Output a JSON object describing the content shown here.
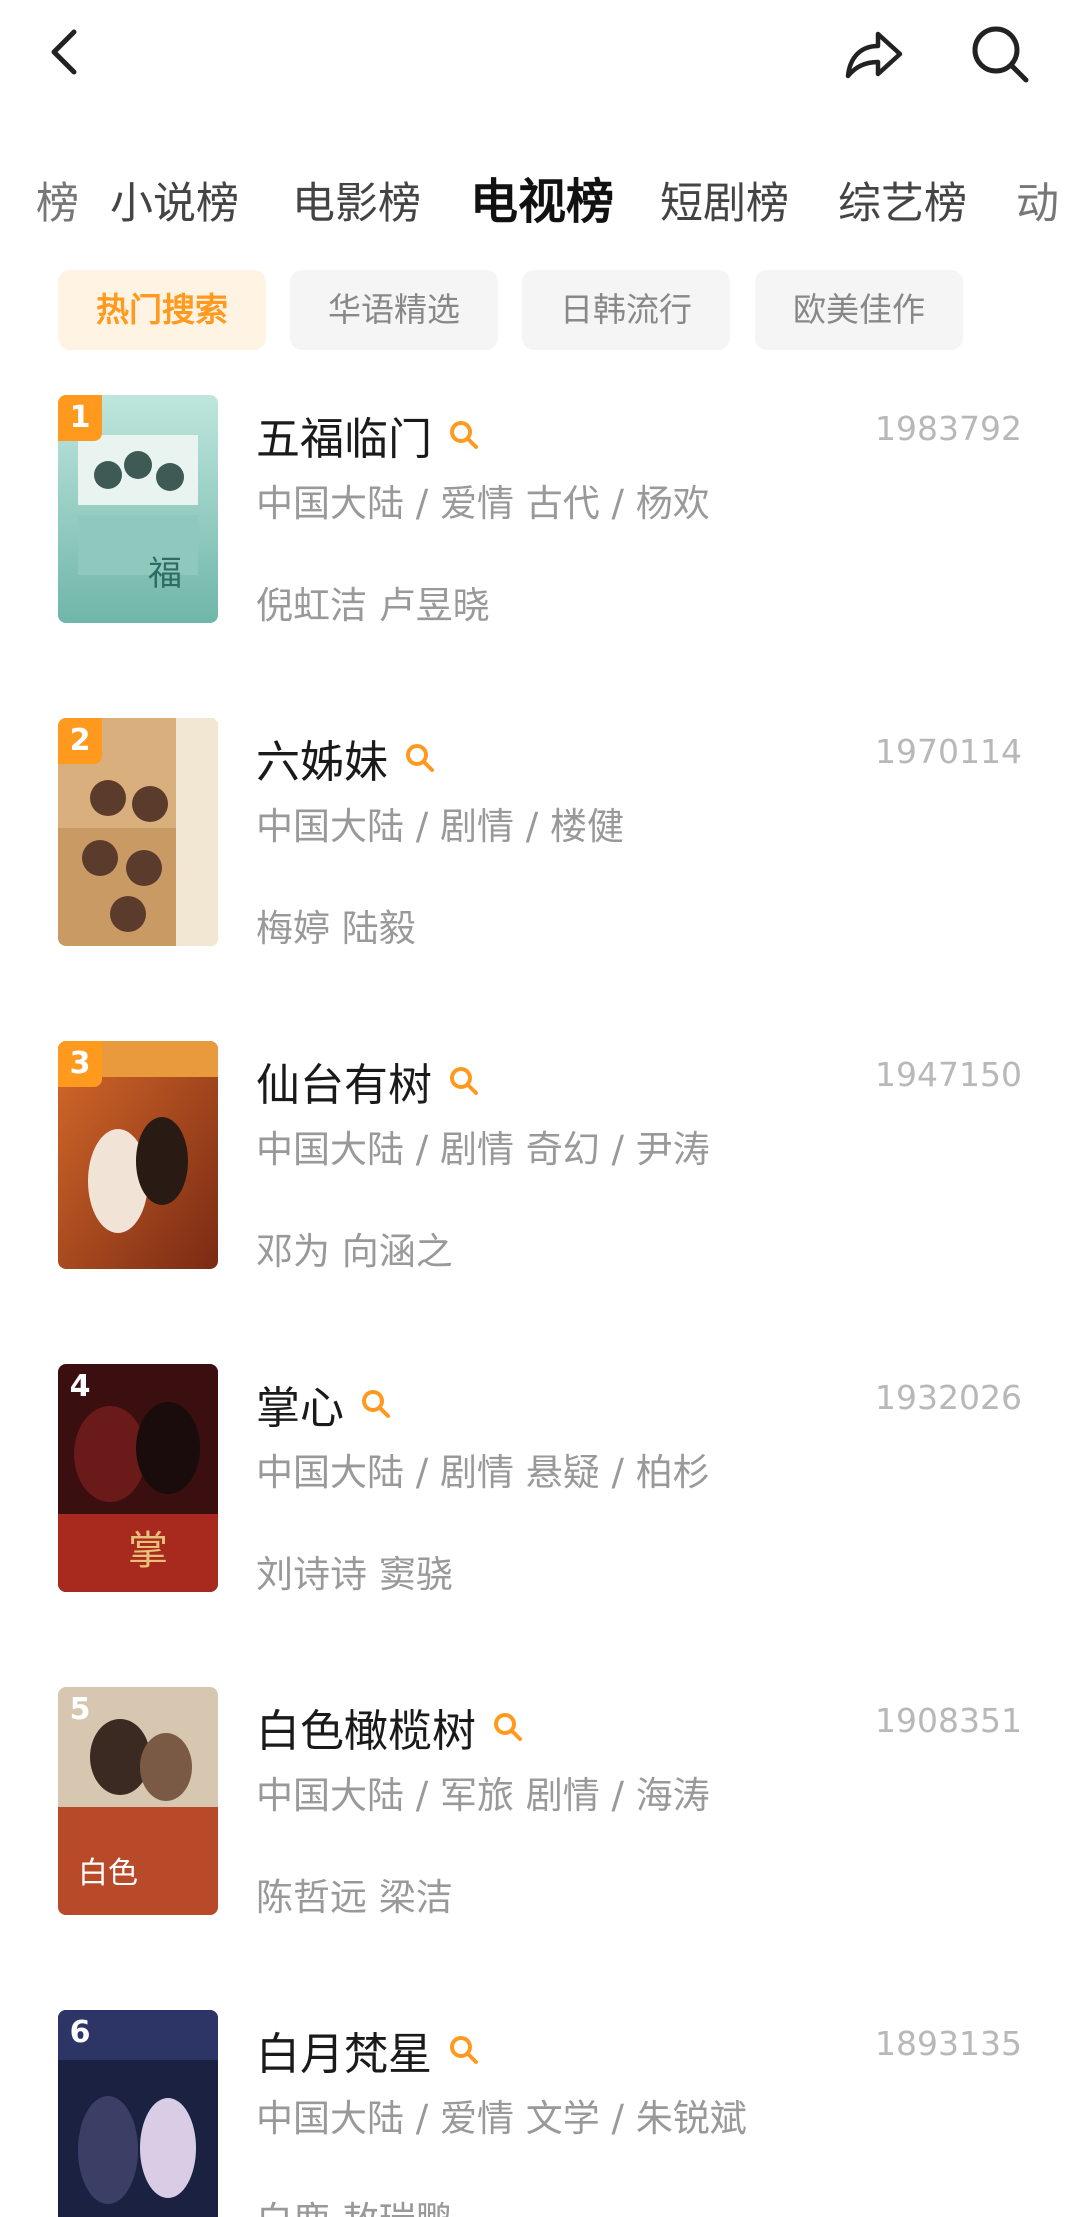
{
  "header": {
    "back": "back-arrow-icon",
    "share": "share-arrow-icon",
    "search": "search-icon"
  },
  "tabs": [
    "榜",
    "小说榜",
    "电影榜",
    "电视榜",
    "短剧榜",
    "综艺榜",
    "动"
  ],
  "chips": [
    "热门搜索",
    "华语精选",
    "日韩流行",
    "欧美佳作"
  ],
  "items": [
    {
      "rank": "1",
      "title": "五福临门",
      "count": "1983792",
      "meta": "中国大陆 / 爱情 古代 / 杨欢",
      "cast": "倪虹洁 卢昱晓"
    },
    {
      "rank": "2",
      "title": "六姊妹",
      "count": "1970114",
      "meta": "中国大陆 / 剧情 / 楼健",
      "cast": "梅婷 陆毅"
    },
    {
      "rank": "3",
      "title": "仙台有树",
      "count": "1947150",
      "meta": "中国大陆 / 剧情 奇幻 / 尹涛",
      "cast": "邓为 向涵之"
    },
    {
      "rank": "4",
      "title": "掌心",
      "count": "1932026",
      "meta": "中国大陆 / 剧情 悬疑 / 柏杉",
      "cast": "刘诗诗 窦骁"
    },
    {
      "rank": "5",
      "title": "白色橄榄树",
      "count": "1908351",
      "meta": "中国大陆 / 军旅 剧情 / 海涛",
      "cast": "陈哲远 梁洁"
    },
    {
      "rank": "6",
      "title": "白月梵星",
      "count": "1893135",
      "meta": "中国大陆 / 爱情 文学 / 朱锐斌",
      "cast": "白鹿 敖瑞鹏"
    }
  ],
  "colors": {
    "accent": "#ff9a1f"
  }
}
